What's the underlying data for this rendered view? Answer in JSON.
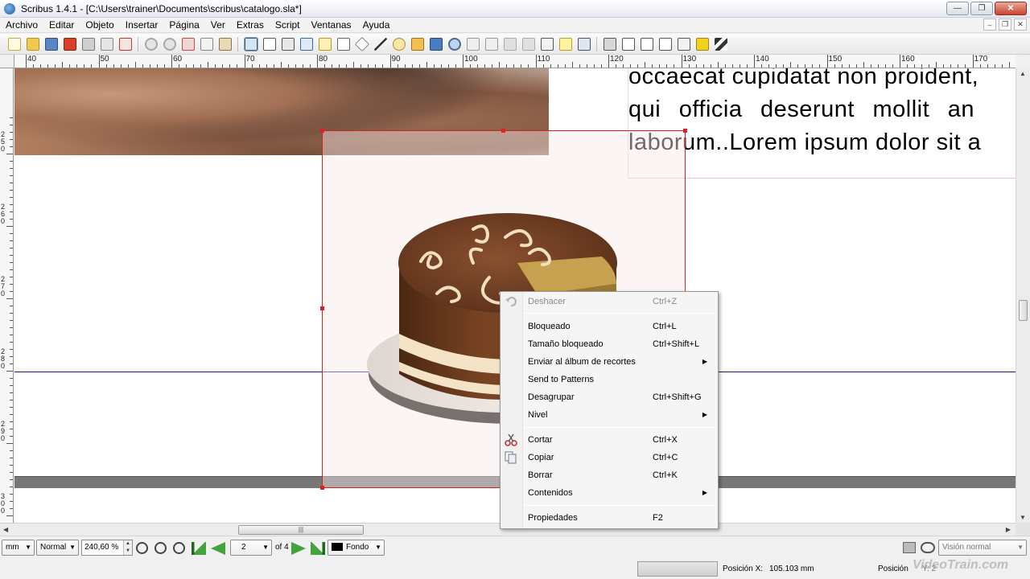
{
  "window": {
    "title": "Scribus 1.4.1 - [C:\\Users\\trainer\\Documents\\scribus\\catalogo.sla*]",
    "minimize": "—",
    "restore": "❐",
    "close": "✕"
  },
  "mdi": {
    "minimize": "–",
    "restore": "❐",
    "close": "✕"
  },
  "menubar": [
    "Archivo",
    "Editar",
    "Objeto",
    "Insertar",
    "Página",
    "Ver",
    "Extras",
    "Script",
    "Ventanas",
    "Ayuda"
  ],
  "ruler": {
    "h_labels": [
      "40",
      "50",
      "60",
      "70",
      "80",
      "90",
      "100",
      "110",
      "120",
      "130",
      "140",
      "150",
      "160",
      "170"
    ],
    "v_labels": [
      [
        "2",
        "5",
        "0"
      ],
      [
        "2",
        "6",
        "0"
      ],
      [
        "2",
        "7",
        "0"
      ],
      [
        "2",
        "8",
        "0"
      ],
      [
        "2",
        "9",
        "0"
      ],
      [
        "3",
        "0",
        "0"
      ]
    ]
  },
  "document": {
    "text_lines": [
      "occaecat cupidatat non proident,",
      "qui  officia  deserunt  mollit  an",
      "laborum..Lorem ipsum dolor sit a"
    ]
  },
  "context_menu": {
    "items": [
      {
        "label": "Deshacer",
        "shortcut": "Ctrl+Z",
        "disabled": true,
        "icon": "undo-icon"
      },
      {
        "label": "Bloqueado",
        "shortcut": "Ctrl+L"
      },
      {
        "label": "Tamaño bloqueado",
        "shortcut": "Ctrl+Shift+L"
      },
      {
        "label": "Enviar al álbum de recortes",
        "shortcut": "",
        "submenu": true
      },
      {
        "label": "Send to Patterns",
        "shortcut": ""
      },
      {
        "label": "Desagrupar",
        "shortcut": "Ctrl+Shift+G"
      },
      {
        "label": "Nivel",
        "shortcut": "",
        "submenu": true
      },
      {
        "label": "Cortar",
        "shortcut": "Ctrl+X",
        "icon": "scissors-icon"
      },
      {
        "label": "Copiar",
        "shortcut": "Ctrl+C",
        "icon": "copy-icon"
      },
      {
        "label": "Borrar",
        "shortcut": "Ctrl+K"
      },
      {
        "label": "Contenidos",
        "shortcut": "",
        "submenu": true
      },
      {
        "label": "Propiedades",
        "shortcut": "F2"
      }
    ],
    "submenu_arrow": "▶"
  },
  "statusbar": {
    "unit": "mm",
    "mode": "Normal",
    "zoom": "240,60 %",
    "page": "2",
    "of_pages": "of 4",
    "layer": "Fondo",
    "view_mode": "Visión normal",
    "pos_x_label": "Posición X:",
    "pos_x_value": "105.103 mm",
    "pos_y_label": "Posición",
    "pos_y_value": "Y: 2",
    "watermark": "VideoTrain.com"
  },
  "colors": {
    "selection": "#d02020",
    "guide": "#1a1a7a",
    "cake_chocolate": "#6b3a1f",
    "cake_cream": "#f3e3c8"
  }
}
